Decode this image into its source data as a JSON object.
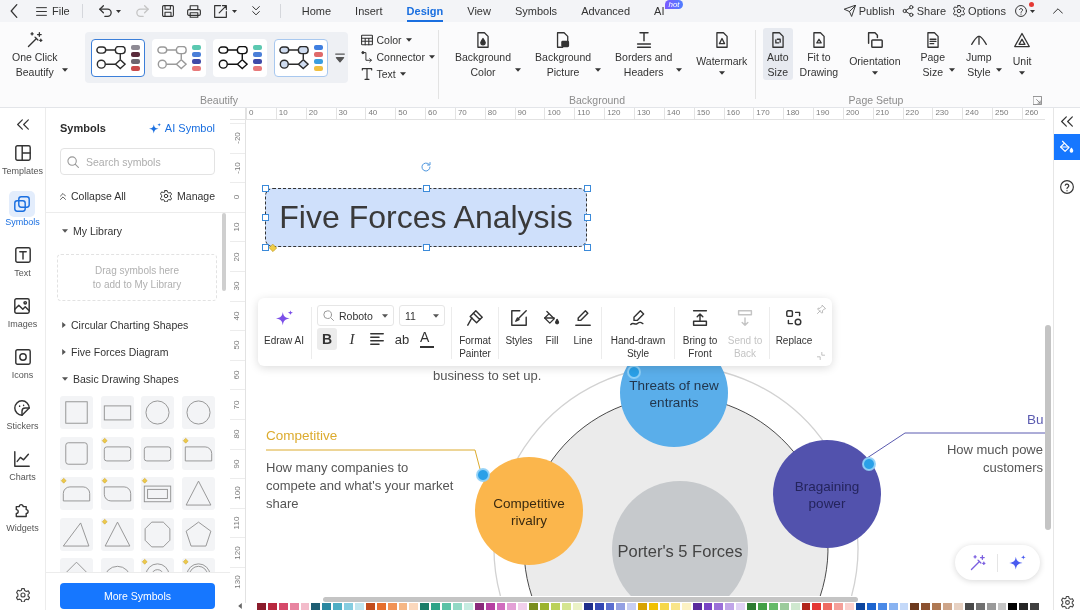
{
  "menu_bar": {
    "file": "File",
    "undo": {
      "disabled": false
    },
    "redo": {
      "disabled": true
    },
    "tabs": [
      {
        "label": "Home",
        "selected": false
      },
      {
        "label": "Insert",
        "selected": false
      },
      {
        "label": "Design",
        "selected": true
      },
      {
        "label": "View",
        "selected": false
      },
      {
        "label": "Symbols",
        "selected": false
      },
      {
        "label": "Advanced",
        "selected": false
      },
      {
        "label": "AI",
        "selected": false,
        "badge": "hot"
      }
    ],
    "actions": [
      {
        "kind": "publish",
        "label": "Publish"
      },
      {
        "kind": "share",
        "label": "Share"
      },
      {
        "kind": "options",
        "label": "Options"
      }
    ],
    "help": {
      "notification": true
    }
  },
  "ribbon": {
    "beautify": {
      "one_click": "One Click\nBeautify",
      "themes": [
        {
          "kind": "classic",
          "selected": true,
          "hovered": false,
          "swatches": [
            {
              "color": "#8e8a94"
            },
            {
              "color": "#5a2a3a"
            },
            {
              "color": "#6e6670"
            },
            {
              "color": "#c94a4a"
            }
          ]
        },
        {
          "kind": "light",
          "selected": false,
          "hovered": false,
          "swatches": [
            {
              "color": "#5bc8b0"
            },
            {
              "color": "#4a7fd8"
            },
            {
              "color": "#3f4aa8"
            },
            {
              "color": "#e87a7a"
            }
          ]
        },
        {
          "kind": "bold",
          "selected": false,
          "hovered": false,
          "swatches": [
            {
              "color": "#5bc8b0"
            },
            {
              "color": "#4a7fd8"
            },
            {
              "color": "#3f4aa8"
            },
            {
              "color": "#e87a7a"
            }
          ]
        },
        {
          "kind": "soft",
          "selected": false,
          "hovered": true,
          "swatches": [
            {
              "color": "#3f7fe0"
            },
            {
              "color": "#e06a6a"
            },
            {
              "color": "#3a9ee0"
            },
            {
              "color": "#f0c040"
            }
          ]
        }
      ],
      "commands": [
        {
          "kind": "color",
          "label": "Color"
        },
        {
          "kind": "connector",
          "label": "Connector"
        },
        {
          "kind": "text",
          "label": "Text"
        }
      ],
      "label": "Beautify"
    },
    "background": {
      "buttons": [
        {
          "kind": "background-color",
          "label": "Background\nColor",
          "dropdown": true
        },
        {
          "kind": "background-picture",
          "label": "Background\nPicture",
          "dropdown": true
        },
        {
          "kind": "borders-headers",
          "label": "Borders and\nHeaders",
          "dropdown": true
        },
        {
          "kind": "watermark",
          "label": "Watermark",
          "dropdown": true
        }
      ],
      "label": "Background"
    },
    "page_setup": {
      "buttons": [
        {
          "kind": "auto-size",
          "label": "Auto\nSize",
          "dropdown": false,
          "selected": true
        },
        {
          "kind": "fit-to-drawing",
          "label": "Fit to\nDrawing",
          "dropdown": false,
          "selected": false
        },
        {
          "kind": "orientation",
          "label": "Orientation",
          "dropdown": true,
          "selected": false
        },
        {
          "kind": "page-size",
          "label": "Page\nSize",
          "dropdown": true,
          "selected": false
        },
        {
          "kind": "jump-style",
          "label": "Jump\nStyle",
          "dropdown": true,
          "selected": false
        },
        {
          "kind": "unit",
          "label": "Unit",
          "dropdown": true,
          "selected": false
        }
      ],
      "label": "Page Setup"
    }
  },
  "left_rail": {
    "items": [
      {
        "kind": "templates",
        "label": "Templates",
        "selected": false
      },
      {
        "kind": "symbols",
        "label": "Symbols",
        "selected": true
      },
      {
        "kind": "text",
        "label": "Text",
        "selected": false
      },
      {
        "kind": "images",
        "label": "Images",
        "selected": false
      },
      {
        "kind": "icons",
        "label": "Icons",
        "selected": false
      },
      {
        "kind": "stickers",
        "label": "Stickers",
        "selected": false
      },
      {
        "kind": "charts",
        "label": "Charts",
        "selected": false
      },
      {
        "kind": "widgets",
        "label": "Widgets",
        "selected": false
      }
    ]
  },
  "symbols_panel": {
    "title": "Symbols",
    "ai_button": "AI Symbol",
    "search": {
      "placeholder": "Search symbols"
    },
    "collapse_all": "Collapse All",
    "manage": "Manage",
    "sections": [
      {
        "label": "My Library",
        "expanded": true,
        "drop_hint": "Drag symbols here\nto add to My Library"
      },
      {
        "label": "Circular Charting Shapes",
        "expanded": false
      },
      {
        "label": "Five Forces Diagram",
        "expanded": false
      },
      {
        "label": "Basic Drawing Shapes",
        "expanded": true,
        "shapes": [
          {
            "kind": "square",
            "adjustable": false
          },
          {
            "kind": "rectangle",
            "adjustable": false
          },
          {
            "kind": "circle",
            "adjustable": false
          },
          {
            "kind": "circle",
            "adjustable": false
          },
          {
            "kind": "rounded-square",
            "adjustable": false
          },
          {
            "kind": "rounded-rectangle",
            "adjustable": true
          },
          {
            "kind": "rounded-rectangle",
            "adjustable": false
          },
          {
            "kind": "round-corner-rectangle",
            "adjustable": true
          },
          {
            "kind": "round-top-rectangle",
            "adjustable": true
          },
          {
            "kind": "snip-rectangle",
            "adjustable": true
          },
          {
            "kind": "frame",
            "adjustable": true
          },
          {
            "kind": "triangle",
            "adjustable": false
          },
          {
            "kind": "right-triangle",
            "adjustable": false
          },
          {
            "kind": "triangle",
            "adjustable": true
          },
          {
            "kind": "octagon",
            "adjustable": false
          },
          {
            "kind": "pentagon",
            "adjustable": false
          },
          {
            "kind": "diamond",
            "adjustable": false
          },
          {
            "kind": "half-circle",
            "adjustable": false
          },
          {
            "kind": "donut",
            "adjustable": true
          },
          {
            "kind": "ring",
            "adjustable": true
          }
        ]
      }
    ],
    "more_button": "More Symbols"
  },
  "rulers": {
    "horizontal": [
      "0",
      "10",
      "20",
      "30",
      "40",
      "50",
      "60",
      "70",
      "80",
      "90",
      "100",
      "110",
      "120",
      "130",
      "140",
      "150",
      "160",
      "170",
      "180",
      "190",
      "200",
      "210",
      "220",
      "230",
      "240",
      "250",
      "260"
    ],
    "vertical": [
      "-20",
      "-10",
      "0",
      "10",
      "20",
      "30",
      "40",
      "50",
      "60",
      "70",
      "80",
      "90",
      "100",
      "110",
      "120",
      "130"
    ]
  },
  "canvas": {
    "title": {
      "text": "Five Forces Analysis",
      "selected": true
    },
    "format_toolbar": {
      "ai": "Edraw AI",
      "font": {
        "value": "Roboto"
      },
      "size": {
        "value": "11"
      },
      "text_tools": [
        {
          "kind": "bold",
          "glyph": "B",
          "selected": true
        },
        {
          "kind": "italic",
          "glyph": "I",
          "selected": false
        },
        {
          "kind": "align",
          "selected": false
        },
        {
          "kind": "case",
          "glyph": "ab",
          "selected": false
        },
        {
          "kind": "font-color",
          "glyph": "A",
          "selected": false
        }
      ],
      "tool_groups": [
        [
          {
            "kind": "format-painter",
            "label": "Format\nPainter",
            "disabled": false
          }
        ],
        [
          {
            "kind": "styles",
            "label": "Styles",
            "disabled": false
          },
          {
            "kind": "fill",
            "label": "Fill",
            "disabled": false
          },
          {
            "kind": "line",
            "label": "Line",
            "disabled": false
          }
        ],
        [
          {
            "kind": "hand-drawn",
            "label": "Hand-drawn\nStyle",
            "disabled": false
          }
        ],
        [
          {
            "kind": "bring-front",
            "label": "Bring to\nFront",
            "disabled": false
          },
          {
            "kind": "send-back",
            "label": "Send to\nBack",
            "disabled": true
          }
        ],
        [
          {
            "kind": "replace",
            "label": "Replace",
            "disabled": false
          }
        ]
      ]
    },
    "diagram": {
      "center": "Porter's 5 Forces",
      "forces": [
        {
          "label": "Threats of new entrants",
          "color": "#5aaeea"
        },
        {
          "label": "Competitive rivalry",
          "color": "#fbb64c"
        },
        {
          "label": "Bragaining power",
          "color": "#5252ad"
        }
      ],
      "notes": [
        {
          "kind": "top",
          "text": "business to set up."
        },
        {
          "kind": "left",
          "heading": "Competitive",
          "text": "How many companies to compete and what's your market share",
          "color": "#dcab2e"
        },
        {
          "kind": "right",
          "heading": "Bu",
          "text": "How much powe customers",
          "color": "#5b5bb0"
        }
      ]
    }
  },
  "right_rail": {
    "tools": [
      {
        "kind": "style",
        "selected": true
      },
      {
        "kind": "help",
        "selected": false
      }
    ]
  },
  "color_palette": [
    {
      "color": "#8b1c2c"
    },
    {
      "color": "#b8283f"
    },
    {
      "color": "#d6496a"
    },
    {
      "color": "#e884a0"
    },
    {
      "color": "#f3bccb"
    },
    {
      "color": "#1d5d72"
    },
    {
      "color": "#2a87a0"
    },
    {
      "color": "#4eaec4"
    },
    {
      "color": "#86cde0"
    },
    {
      "color": "#c1e6ef"
    },
    {
      "color": "#c24d1c"
    },
    {
      "color": "#e66f2d"
    },
    {
      "color": "#f19255"
    },
    {
      "color": "#f6b785"
    },
    {
      "color": "#fbd8bd"
    },
    {
      "color": "#1b7d68"
    },
    {
      "color": "#2ea387"
    },
    {
      "color": "#5bc2a6"
    },
    {
      "color": "#92d9c5"
    },
    {
      "color": "#c6ece1"
    },
    {
      "color": "#8a2a7b"
    },
    {
      "color": "#b63fa2"
    },
    {
      "color": "#d06cbe"
    },
    {
      "color": "#e3a0d6"
    },
    {
      "color": "#f1cfeb"
    },
    {
      "color": "#7a8e1f"
    },
    {
      "color": "#9bb32b"
    },
    {
      "color": "#bbd159"
    },
    {
      "color": "#d5e590"
    },
    {
      "color": "#ebf2c6"
    },
    {
      "color": "#1f2e8a"
    },
    {
      "color": "#3347b3"
    },
    {
      "color": "#5a6ecf"
    },
    {
      "color": "#93a0e2"
    },
    {
      "color": "#c7cef2"
    },
    {
      "color": "#d8a300"
    },
    {
      "color": "#f1c100"
    },
    {
      "color": "#f6d748"
    },
    {
      "color": "#f9e589"
    },
    {
      "color": "#fdf2c3"
    },
    {
      "color": "#5a2a9c"
    },
    {
      "color": "#7943c4"
    },
    {
      "color": "#9b70d8"
    },
    {
      "color": "#c0a5e8"
    },
    {
      "color": "#e0d2f5"
    },
    {
      "color": "#2d7c31"
    },
    {
      "color": "#42a046"
    },
    {
      "color": "#65ba69"
    },
    {
      "color": "#9bcb9b"
    },
    {
      "color": "#cfe8cf"
    },
    {
      "color": "#b2251d"
    },
    {
      "color": "#e43834"
    },
    {
      "color": "#ee6b62"
    },
    {
      "color": "#f4a09a"
    },
    {
      "color": "#fad0cd"
    },
    {
      "color": "#0d469f"
    },
    {
      "color": "#1d65cf"
    },
    {
      "color": "#4989e7"
    },
    {
      "color": "#89b3f1"
    },
    {
      "color": "#c4d9f9"
    },
    {
      "color": "#6c3a1e"
    },
    {
      "color": "#8c512f"
    },
    {
      "color": "#af7954"
    },
    {
      "color": "#cea589"
    },
    {
      "color": "#e7d1c2"
    },
    {
      "color": "#4a4a4a"
    },
    {
      "color": "#717171"
    },
    {
      "color": "#9a9a9a"
    },
    {
      "color": "#c5c5c5"
    },
    {
      "color": "#000000"
    },
    {
      "color": "#262626"
    },
    {
      "color": "#404040"
    }
  ]
}
